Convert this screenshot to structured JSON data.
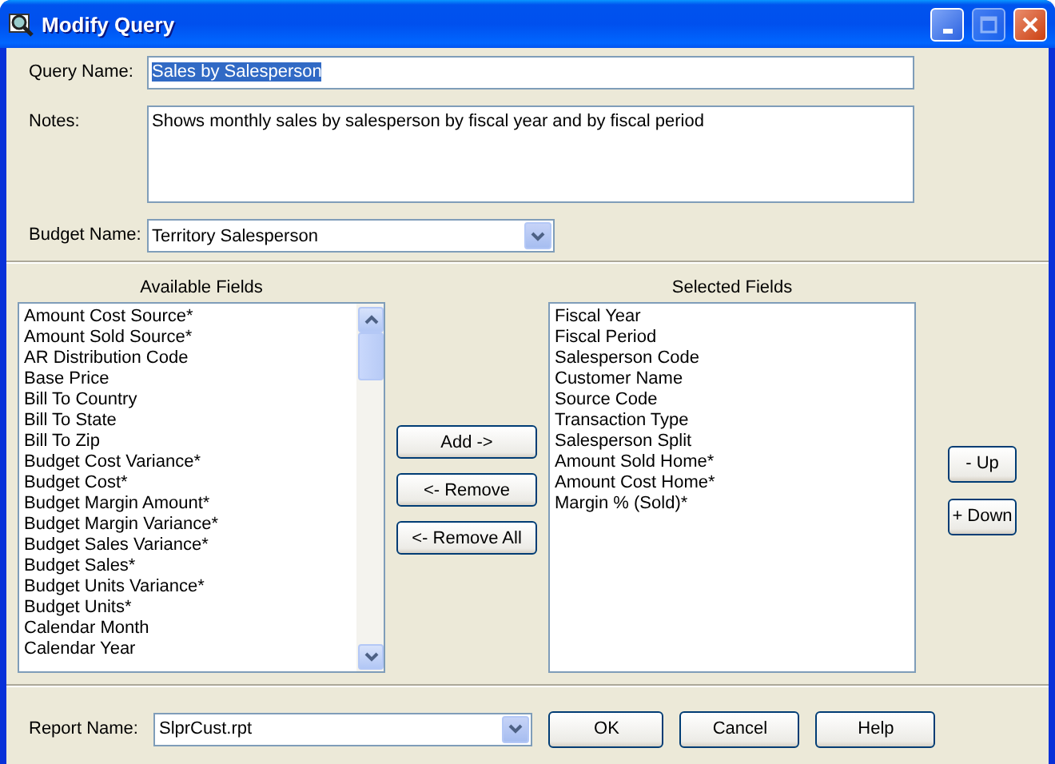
{
  "window": {
    "title": "Modify Query"
  },
  "query_name": {
    "label": "Query Name:",
    "value": "Sales by Salesperson",
    "text_selected": true
  },
  "notes": {
    "label": "Notes:",
    "value": "Shows monthly sales by salesperson by fiscal year and by fiscal period"
  },
  "budget_name": {
    "label": "Budget Name:",
    "value": "Territory Salesperson"
  },
  "available_fields": {
    "title": "Available Fields",
    "items": [
      "Amount Cost Source*",
      "Amount Sold Source*",
      "AR Distribution Code",
      "Base Price",
      "Bill To Country",
      "Bill To State",
      "Bill To Zip",
      "Budget Cost Variance*",
      "Budget Cost*",
      "Budget Margin Amount*",
      "Budget Margin Variance*",
      "Budget Sales Variance*",
      "Budget Sales*",
      "Budget Units Variance*",
      "Budget Units*",
      "Calendar Month",
      "Calendar Year"
    ]
  },
  "transfer_buttons": [
    "Add ->",
    "<- Remove",
    "<- Remove All"
  ],
  "selected_fields": {
    "title": "Selected Fields",
    "items": [
      "Fiscal Year",
      "Fiscal Period",
      "Salesperson Code",
      "Customer Name",
      "Source Code",
      "Transaction Type",
      "Salesperson Split",
      "Amount Sold Home*",
      "Amount Cost Home*",
      "Margin % (Sold)*"
    ]
  },
  "order_buttons": [
    "- Up",
    "+ Down"
  ],
  "report_name": {
    "label": "Report Name:",
    "value": "SlprCust.rpt"
  },
  "buttons": [
    "OK",
    "Cancel",
    "Help"
  ]
}
